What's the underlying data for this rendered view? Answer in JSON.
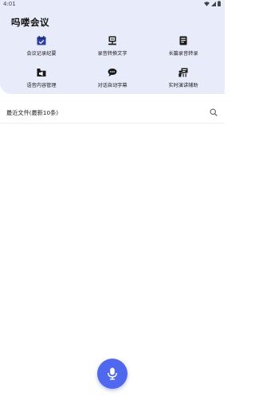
{
  "status_bar": {
    "time": "4:01",
    "icons": [
      "wifi-icon",
      "cell-signal-icon",
      "battery-icon"
    ]
  },
  "header": {
    "app_title": "吗喽会议",
    "background": "#e8ebfa"
  },
  "features": [
    {
      "label": "会议记录纪要",
      "icon": "calendar-icon"
    },
    {
      "label": "录音转换文字",
      "icon": "monitor-icon"
    },
    {
      "label": "长篇录音转录",
      "icon": "document-icon"
    },
    {
      "label": "语音内容管理",
      "icon": "voice-folder-icon"
    },
    {
      "label": "对话自动字幕",
      "icon": "chat-bubble-icon"
    },
    {
      "label": "实时演讲辅助",
      "icon": "presentation-icon"
    }
  ],
  "recent_files": {
    "title": "最近文件(最新10条)",
    "search_icon": "search-icon",
    "items": []
  },
  "record": {
    "icon": "microphone-icon",
    "accent": "#4f68ee"
  }
}
